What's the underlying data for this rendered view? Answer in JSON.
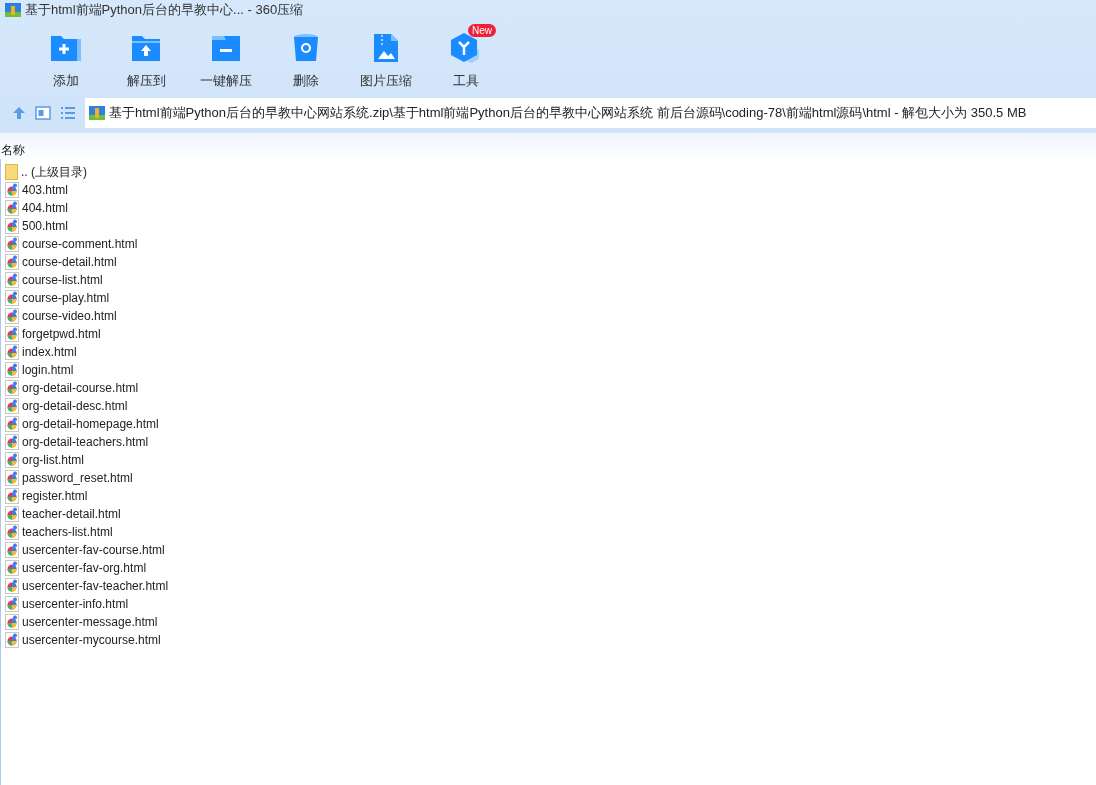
{
  "window": {
    "title": "基于html前端Python后台的早教中心... - 360压缩"
  },
  "toolbar": [
    {
      "kind": "add",
      "label": "添加"
    },
    {
      "kind": "extract",
      "label": "解压到"
    },
    {
      "kind": "quick",
      "label": "一键解压"
    },
    {
      "kind": "delete",
      "label": "删除"
    },
    {
      "kind": "image",
      "label": "图片压缩"
    },
    {
      "kind": "tools",
      "label": "工具",
      "badge": "New"
    }
  ],
  "address": {
    "path": "基于html前端Python后台的早教中心网站系统.zip\\基于html前端Python后台的早教中心网站系统 前后台源码\\coding-78\\前端html源码\\html - 解包大小为 350.5 MB"
  },
  "table": {
    "columns": [
      "名称"
    ],
    "rows": [
      {
        "kind": "parent",
        "name": ".. (上级目录)"
      },
      {
        "kind": "file",
        "name": "403.html"
      },
      {
        "kind": "file",
        "name": "404.html"
      },
      {
        "kind": "file",
        "name": "500.html"
      },
      {
        "kind": "file",
        "name": "course-comment.html"
      },
      {
        "kind": "file",
        "name": "course-detail.html"
      },
      {
        "kind": "file",
        "name": "course-list.html"
      },
      {
        "kind": "file",
        "name": "course-play.html"
      },
      {
        "kind": "file",
        "name": "course-video.html"
      },
      {
        "kind": "file",
        "name": "forgetpwd.html"
      },
      {
        "kind": "file",
        "name": "index.html"
      },
      {
        "kind": "file",
        "name": "login.html"
      },
      {
        "kind": "file",
        "name": "org-detail-course.html"
      },
      {
        "kind": "file",
        "name": "org-detail-desc.html"
      },
      {
        "kind": "file",
        "name": "org-detail-homepage.html"
      },
      {
        "kind": "file",
        "name": "org-detail-teachers.html"
      },
      {
        "kind": "file",
        "name": "org-list.html"
      },
      {
        "kind": "file",
        "name": "password_reset.html"
      },
      {
        "kind": "file",
        "name": "register.html"
      },
      {
        "kind": "file",
        "name": "teacher-detail.html"
      },
      {
        "kind": "file",
        "name": "teachers-list.html"
      },
      {
        "kind": "file",
        "name": "usercenter-fav-course.html"
      },
      {
        "kind": "file",
        "name": "usercenter-fav-org.html"
      },
      {
        "kind": "file",
        "name": "usercenter-fav-teacher.html"
      },
      {
        "kind": "file",
        "name": "usercenter-info.html"
      },
      {
        "kind": "file",
        "name": "usercenter-message.html"
      },
      {
        "kind": "file",
        "name": "usercenter-mycourse.html"
      }
    ]
  }
}
